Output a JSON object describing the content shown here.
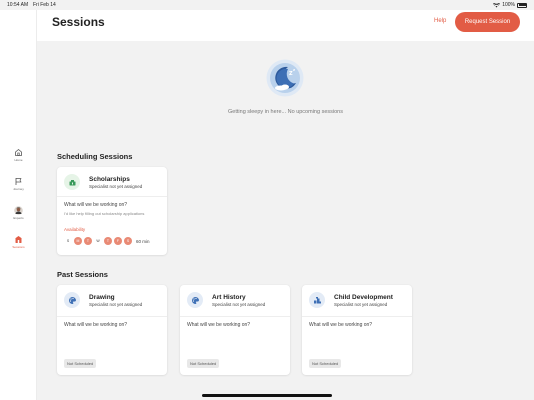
{
  "status_bar": {
    "time": "10:54 AM",
    "date": "Fri Feb 14",
    "battery": "100%"
  },
  "sidebar": {
    "items": [
      {
        "label": "Home",
        "icon": "home-icon",
        "active": false
      },
      {
        "label": "Journey",
        "icon": "flag-icon",
        "active": false
      },
      {
        "label": "Experts",
        "icon": "avatar-icon",
        "active": false
      },
      {
        "label": "Sessions",
        "icon": "sessions-icon",
        "active": true
      }
    ]
  },
  "header": {
    "title": "Sessions",
    "help_label": "Help",
    "request_label": "Request Session"
  },
  "empty_state": {
    "icon": "sleeping-moon-icon",
    "text": "Getting sleepy in here... No upcoming sessions"
  },
  "scheduling": {
    "title": "Scheduling Sessions",
    "cards": [
      {
        "name": "Scholarships",
        "specialist": "Specialist not yet assigned",
        "icon": "scholarship-icon",
        "question": "What will we be working on?",
        "answer": "I'd like help filling out scholarship applications",
        "availability_label": "Availability",
        "days": [
          {
            "label": "S",
            "on": false
          },
          {
            "label": "M",
            "on": true
          },
          {
            "label": "T",
            "on": true
          },
          {
            "label": "W",
            "on": false
          },
          {
            "label": "T",
            "on": true
          },
          {
            "label": "F",
            "on": true
          },
          {
            "label": "S",
            "on": true
          }
        ],
        "duration": "60 min"
      }
    ]
  },
  "past": {
    "title": "Past Sessions",
    "cards": [
      {
        "name": "Drawing",
        "specialist": "Specialist not yet assigned",
        "icon": "palette-icon",
        "question": "What will we be working on?",
        "status": "Not Scheduled"
      },
      {
        "name": "Art History",
        "specialist": "Specialist not yet assigned",
        "icon": "palette-icon",
        "question": "What will we be working on?",
        "status": "Not Scheduled"
      },
      {
        "name": "Child Development",
        "specialist": "Specialist not yet assigned",
        "icon": "child-development-icon",
        "question": "What will we be working on?",
        "status": "Not Scheduled"
      }
    ]
  },
  "colors": {
    "accent": "#e25c45",
    "background": "#f2f2f2",
    "card": "#ffffff"
  }
}
